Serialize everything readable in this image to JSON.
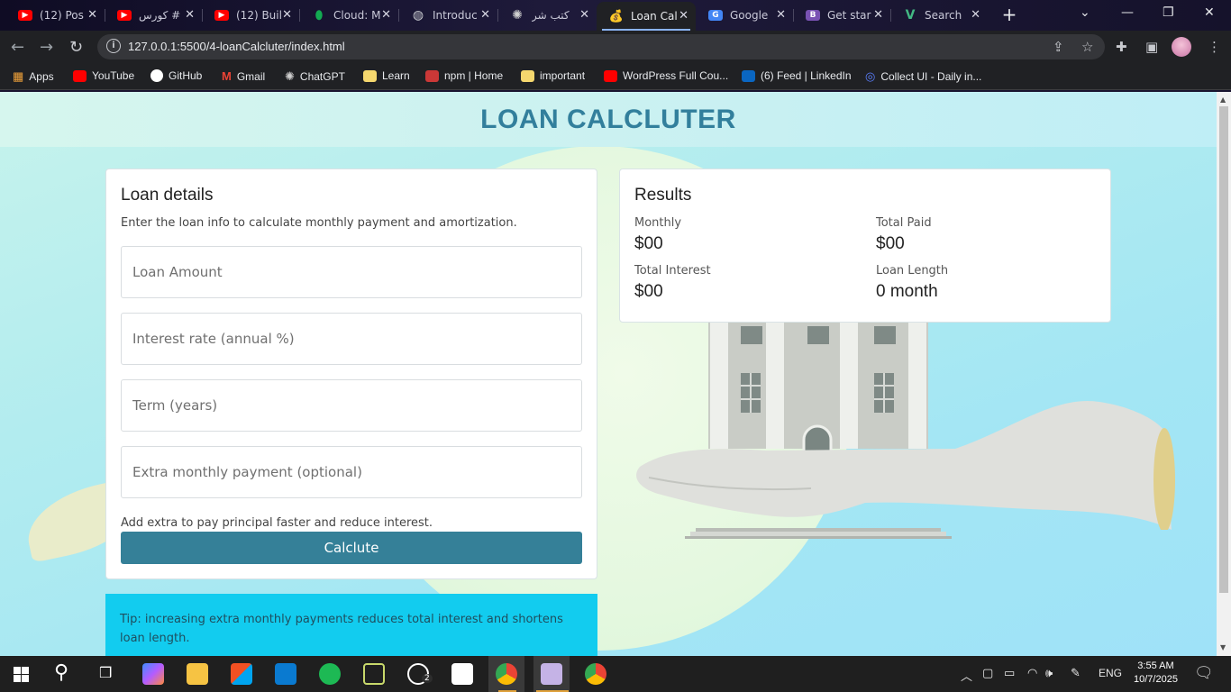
{
  "browser": {
    "tabs": [
      {
        "title": "(12) Pos",
        "icon": "youtube-icon",
        "color": "#ff0000"
      },
      {
        "title": "كورس #",
        "icon": "youtube-icon",
        "color": "#ff0000"
      },
      {
        "title": "(12) Buil",
        "icon": "youtube-icon",
        "color": "#ff0000"
      },
      {
        "title": "Cloud: M",
        "icon": "mongodb-icon",
        "color": "#13aa52"
      },
      {
        "title": "Introduc",
        "icon": "globe-icon",
        "color": "#9aa0a6"
      },
      {
        "title": "كتب شر",
        "icon": "chatgpt-icon",
        "color": "#cfcfcf"
      },
      {
        "title": "Loan Cal",
        "icon": "moneybag-icon",
        "color": "#e8b84a"
      },
      {
        "title": "Google",
        "icon": "google-translate-icon",
        "color": "#4285f4"
      },
      {
        "title": "Get star",
        "icon": "bootstrap-icon",
        "color": "#7952b3"
      },
      {
        "title": "Search",
        "icon": "vue-icon",
        "color": "#42b883"
      }
    ],
    "url": "127.0.0.1:5500/4-loanCalcluter/index.html",
    "bookmarks": [
      {
        "label": "Apps",
        "icon": "apps-grid-icon",
        "color": "#f2a33a"
      },
      {
        "label": "YouTube",
        "icon": "youtube-icon",
        "color": "#ff0000"
      },
      {
        "label": "GitHub",
        "icon": "github-icon",
        "color": "#ffffff"
      },
      {
        "label": "Gmail",
        "icon": "gmail-icon",
        "color": "#ea4335"
      },
      {
        "label": "ChatGPT",
        "icon": "chatgpt-icon",
        "color": "#cfcfcf"
      },
      {
        "label": "Learn",
        "icon": "folder-icon",
        "color": "#f5d76e"
      },
      {
        "label": "npm | Home",
        "icon": "npm-icon",
        "color": "#cb3837"
      },
      {
        "label": "important",
        "icon": "folder-icon",
        "color": "#f5d76e"
      },
      {
        "label": "WordPress Full Cou...",
        "icon": "youtube-icon",
        "color": "#ff0000"
      },
      {
        "label": "(6) Feed | LinkedIn",
        "icon": "linkedin-icon",
        "color": "#0a66c2"
      },
      {
        "label": "Collect UI - Daily in...",
        "icon": "collectui-icon",
        "color": "#5b7fff"
      }
    ]
  },
  "page": {
    "title": "LOAN CALCLUTER",
    "loan_card": {
      "heading": "Loan details",
      "subtitle": "Enter the loan info to calculate monthly payment and amortization.",
      "fields": {
        "amount_placeholder": "Loan Amount",
        "rate_placeholder": "Interest rate (annual %)",
        "term_placeholder": "Term (years)",
        "extra_placeholder": "Extra monthly payment (optional)"
      },
      "hint": "Add extra to pay principal faster and reduce interest.",
      "button": "Calclute"
    },
    "tip": "Tip: increasing extra monthly payments reduces total interest and shortens loan length.",
    "results": {
      "heading": "Results",
      "monthly_label": "Monthly",
      "monthly_value": "$00",
      "total_paid_label": "Total Paid",
      "total_paid_value": "$00",
      "total_interest_label": "Total Interest",
      "total_interest_value": "$00",
      "loan_length_label": "Loan Length",
      "loan_length_value": "0 month"
    }
  },
  "taskbar": {
    "language": "ENG",
    "time": "3:55 AM",
    "date": "10/7/2025",
    "whatsapp_badge": "2"
  },
  "colors": {
    "accent": "#358098",
    "title": "#327f9c",
    "tip_bg": "#12ccef"
  }
}
